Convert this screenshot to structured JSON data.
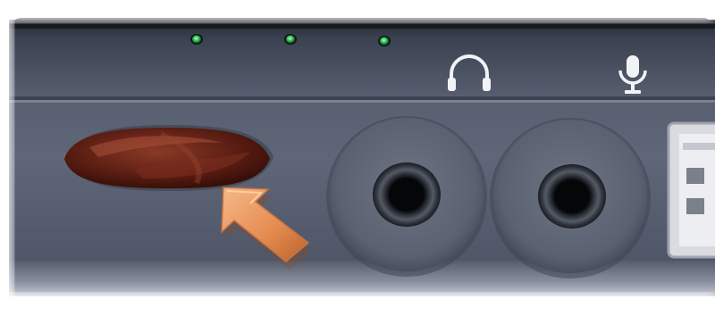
{
  "scene": {
    "subject": "laptop-side-panel",
    "colors": {
      "panel_top": "#3c4452",
      "panel_main": "#5b6273",
      "panel_light": "#7c8394",
      "led_green": "#3fd06a",
      "ir_lens": "#5a1e14",
      "arrow": "#e8935a",
      "jack_ring": "#6f7685",
      "jack_hole": "#0d0f14"
    },
    "leds": [
      {
        "name": "led-indicator-1",
        "icon": "green-led"
      },
      {
        "name": "led-indicator-2",
        "icon": "green-led"
      },
      {
        "name": "led-indicator-3",
        "icon": "green-led"
      }
    ],
    "port_icons": [
      {
        "name": "headphone-icon",
        "icon": "headphones"
      },
      {
        "name": "microphone-icon",
        "icon": "microphone"
      }
    ],
    "highlight_arrow": {
      "icon": "arrow",
      "points_to": "infrared-sensor"
    }
  }
}
